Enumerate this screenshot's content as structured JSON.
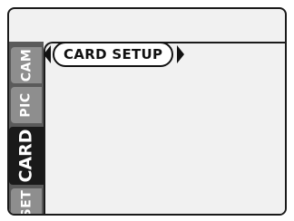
{
  "tabs": {
    "cam": "CAM",
    "pic": "PIC",
    "card": "CARD",
    "set": "SET"
  },
  "menu": {
    "title": "CARD SETUP",
    "left_icon": "triangle-left-icon",
    "right_icon": "triangle-right-icon"
  },
  "colors": {
    "background": "#f1f1f1",
    "tab_inactive": "#8e8e8e",
    "tab_active": "#1a1a1a",
    "text_dark": "#111111"
  }
}
